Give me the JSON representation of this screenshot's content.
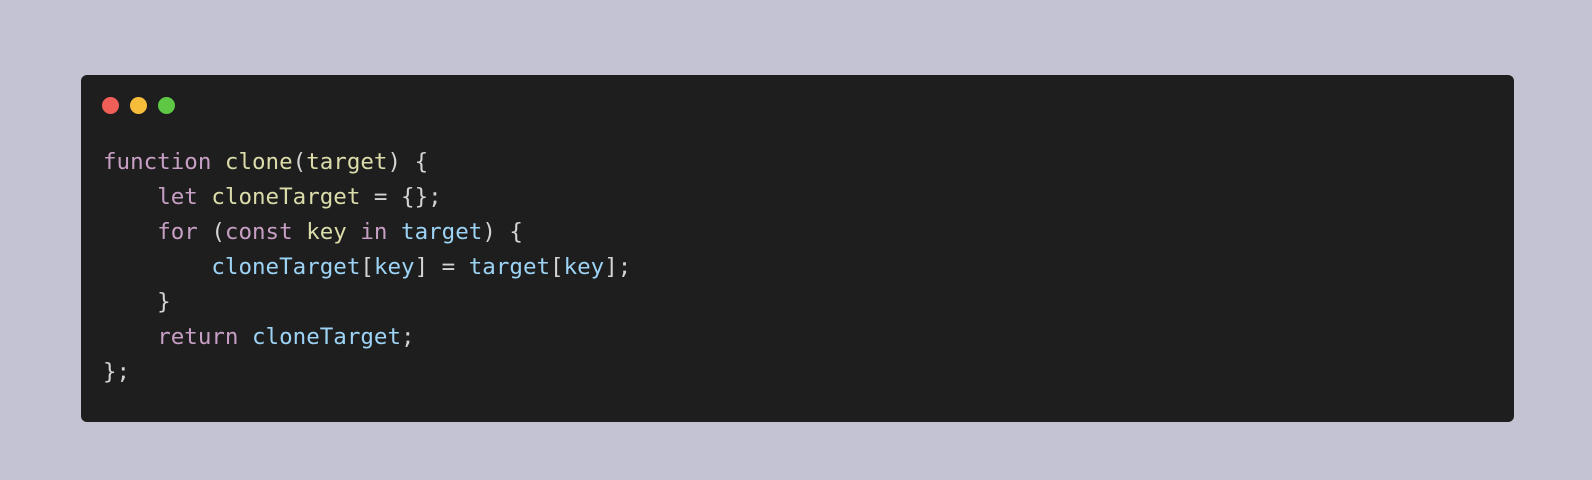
{
  "window": {
    "buttons": [
      {
        "name": "close",
        "color": "#ef5f57"
      },
      {
        "name": "minimize",
        "color": "#f6bd3b"
      },
      {
        "name": "maximize",
        "color": "#5ec844"
      }
    ]
  },
  "colors": {
    "background": "#c4c3d4",
    "editor": "#1e1e1e",
    "keyword": "#c79fc4",
    "function": "#dcdcab",
    "variable": "#9dd3f5",
    "plain": "#d4d4d4"
  },
  "code": {
    "lines": [
      [
        {
          "t": "function",
          "c": "keyword"
        },
        {
          "t": " ",
          "c": "plain"
        },
        {
          "t": "clone",
          "c": "function"
        },
        {
          "t": "(",
          "c": "plain"
        },
        {
          "t": "target",
          "c": "function"
        },
        {
          "t": ") {",
          "c": "plain"
        }
      ],
      [
        {
          "t": "    ",
          "c": "plain"
        },
        {
          "t": "let",
          "c": "keyword"
        },
        {
          "t": " ",
          "c": "plain"
        },
        {
          "t": "cloneTarget",
          "c": "function"
        },
        {
          "t": " = {};",
          "c": "plain"
        }
      ],
      [
        {
          "t": "    ",
          "c": "plain"
        },
        {
          "t": "for",
          "c": "keyword"
        },
        {
          "t": " (",
          "c": "plain"
        },
        {
          "t": "const",
          "c": "keyword"
        },
        {
          "t": " ",
          "c": "plain"
        },
        {
          "t": "key",
          "c": "function"
        },
        {
          "t": " ",
          "c": "plain"
        },
        {
          "t": "in",
          "c": "keyword"
        },
        {
          "t": " ",
          "c": "plain"
        },
        {
          "t": "target",
          "c": "variable"
        },
        {
          "t": ") {",
          "c": "plain"
        }
      ],
      [
        {
          "t": "        ",
          "c": "plain"
        },
        {
          "t": "cloneTarget",
          "c": "variable"
        },
        {
          "t": "[",
          "c": "plain"
        },
        {
          "t": "key",
          "c": "variable"
        },
        {
          "t": "] = ",
          "c": "plain"
        },
        {
          "t": "target",
          "c": "variable"
        },
        {
          "t": "[",
          "c": "plain"
        },
        {
          "t": "key",
          "c": "variable"
        },
        {
          "t": "];",
          "c": "plain"
        }
      ],
      [
        {
          "t": "    }",
          "c": "plain"
        }
      ],
      [
        {
          "t": "    ",
          "c": "plain"
        },
        {
          "t": "return",
          "c": "keyword"
        },
        {
          "t": " ",
          "c": "plain"
        },
        {
          "t": "cloneTarget",
          "c": "variable"
        },
        {
          "t": ";",
          "c": "plain"
        }
      ],
      [
        {
          "t": "};",
          "c": "plain"
        }
      ]
    ]
  }
}
